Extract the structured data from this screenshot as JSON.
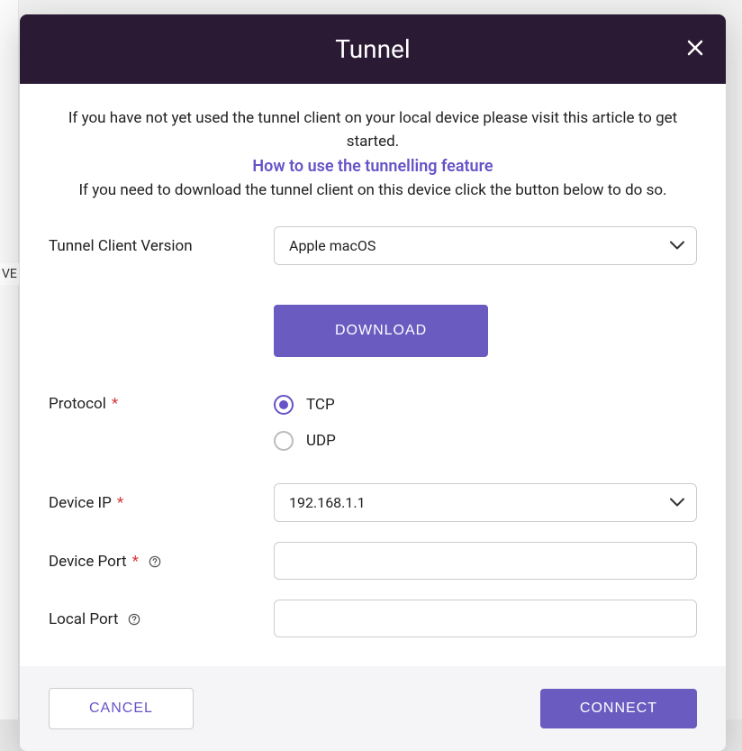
{
  "modal": {
    "title": "Tunnel",
    "intro_line1": "If you have not yet used the tunnel client on your local device please visit this article to get started.",
    "intro_link": "How to use the tunnelling feature",
    "intro_line2": "If you need to download the tunnel client on this device click the button below to do so.",
    "labels": {
      "client_version": "Tunnel Client Version",
      "protocol": "Protocol",
      "device_ip": "Device IP",
      "device_port": "Device Port",
      "local_port": "Local Port"
    },
    "client_version_value": "Apple macOS",
    "download_label": "DOWNLOAD",
    "protocol_options": {
      "tcp": "TCP",
      "udp": "UDP"
    },
    "device_ip_value": "192.168.1.1",
    "device_port_value": "",
    "local_port_value": "",
    "footer": {
      "cancel": "CANCEL",
      "connect": "CONNECT"
    }
  },
  "backdrop": {
    "partial_text": "VE"
  }
}
